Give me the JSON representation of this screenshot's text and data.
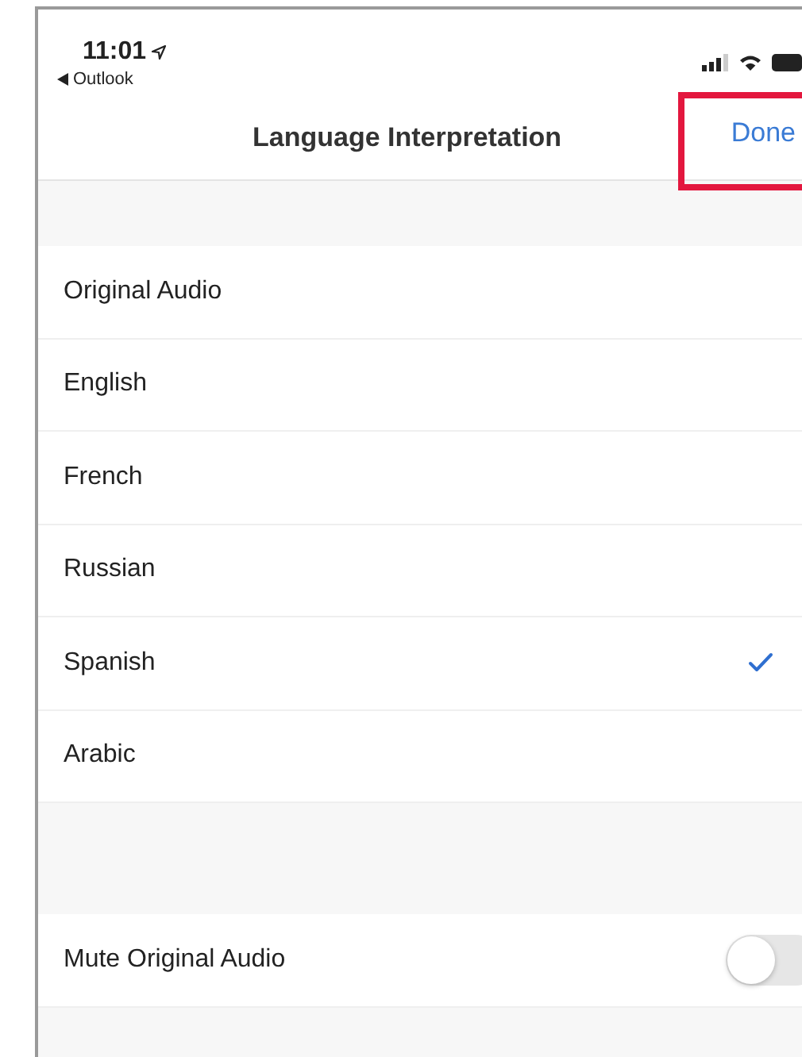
{
  "status_bar": {
    "time": "11:01",
    "back_app": "Outlook"
  },
  "nav_bar": {
    "title": "Language Interpretation",
    "done_button": "Done",
    "highlighted": true
  },
  "languages": [
    {
      "label": "Original Audio",
      "selected": false
    },
    {
      "label": "English",
      "selected": false
    },
    {
      "label": "French",
      "selected": false
    },
    {
      "label": "Russian",
      "selected": false
    },
    {
      "label": "Spanish",
      "selected": true
    },
    {
      "label": "Arabic",
      "selected": false
    }
  ],
  "mute_original_audio": {
    "label": "Mute Original Audio",
    "on": false
  }
}
